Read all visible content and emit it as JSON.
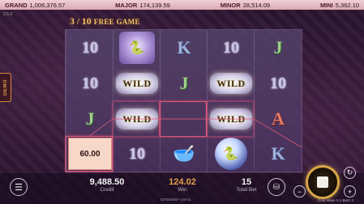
{
  "jackpots": [
    {
      "label": "GRAND",
      "value": "1,006,376.57"
    },
    {
      "label": "MAJOR",
      "value": "174,139.59"
    },
    {
      "label": "MINOR",
      "value": "28,514.09"
    },
    {
      "label": "MINI",
      "value": "5,362.10"
    }
  ],
  "version": "3.5.0",
  "demo_label": "DEMO",
  "free_games": {
    "current": "3",
    "separator": "/",
    "total": "10",
    "label": "FREE GAME"
  },
  "reels": [
    [
      "10",
      "10",
      "J",
      "60.00"
    ],
    [
      "snake-orb",
      "WILD",
      "WILD",
      "10"
    ],
    [
      "K",
      "J",
      "",
      "bowl"
    ],
    [
      "10",
      "WILD",
      "WILD",
      "snake-orb"
    ],
    [
      "J",
      "10",
      "A",
      "K"
    ]
  ],
  "coin_value": "60.00",
  "wild_label": "WILD",
  "footer": {
    "credit_value": "9,488.50",
    "credit_label": "Credit",
    "win_value": "124.02",
    "win_label": "Win",
    "bet_value": "15",
    "bet_label": "Total Bet",
    "session_id": "537609387- Demo",
    "coin_value_text": "Coin Value 0.1 BetX 3"
  },
  "icons": {
    "menu": "menu-icon",
    "coins": "coins-icon",
    "spin": "stop-icon",
    "autoplay": "autoplay-icon",
    "minus": "minus-icon",
    "plus": "plus-icon"
  },
  "colors": {
    "jackpot_bar": "#e8bcc6",
    "gold": "#d8a64a",
    "win_amount": "#e6a24a",
    "payline": "#e05a7a"
  }
}
